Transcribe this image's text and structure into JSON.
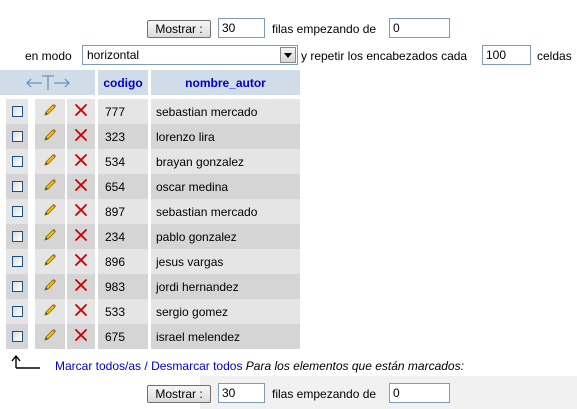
{
  "top_nav": {
    "show_button": "Mostrar :",
    "rows_value": "30",
    "rows_label": "filas empezando de",
    "start_value": "0"
  },
  "mode_bar": {
    "mode_label": "en modo",
    "mode_value": "horizontal",
    "repeat_label": "y repetir los encabezados cada",
    "repeat_value": "100",
    "cells_label": "celdas"
  },
  "table": {
    "columns": [
      "codigo",
      "nombre_autor"
    ],
    "rows": [
      {
        "codigo": "777",
        "nombre_autor": "sebastian mercado"
      },
      {
        "codigo": "323",
        "nombre_autor": "lorenzo lira"
      },
      {
        "codigo": "534",
        "nombre_autor": "brayan gonzalez"
      },
      {
        "codigo": "654",
        "nombre_autor": "oscar medina"
      },
      {
        "codigo": "897",
        "nombre_autor": "sebastian mercado"
      },
      {
        "codigo": "234",
        "nombre_autor": "pablo gonzalez"
      },
      {
        "codigo": "896",
        "nombre_autor": "jesus vargas"
      },
      {
        "codigo": "983",
        "nombre_autor": "jordi hernandez"
      },
      {
        "codigo": "533",
        "nombre_autor": "sergio gomez"
      },
      {
        "codigo": "675",
        "nombre_autor": "israel melendez"
      }
    ]
  },
  "mark_bar": {
    "mark_all": "Marcar todos/as",
    "separator": "/",
    "unmark_all": "Desmarcar todos",
    "with_selected": "Para los elementos que están marcados:"
  },
  "bottom_nav": {
    "show_button": "Mostrar :",
    "rows_value": "30",
    "rows_label": "filas empezando de",
    "start_value": "0"
  },
  "colors": {
    "header_bg": "#d0dce8",
    "row_even": "#e5e5e5",
    "row_odd": "#d5d5d5",
    "link": "#0000cc",
    "delete_red": "#cc0000"
  },
  "icons": {
    "edit": "pencil-icon",
    "delete": "x-icon",
    "column_arrows": "left-right-arrows-icon",
    "mark_arrow": "arrow-up-left-icon",
    "dropdown": "chevron-down-icon"
  }
}
